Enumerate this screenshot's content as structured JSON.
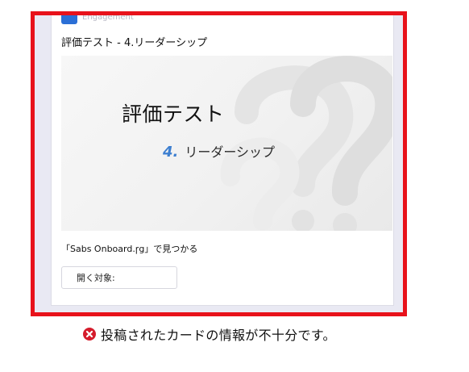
{
  "card": {
    "app_name": "Engagement",
    "title": "評価テスト - 4.リーダーシップ",
    "hero": {
      "title": "評価テスト",
      "subtitle_number": "4.",
      "subtitle_text": "リーダーシップ"
    },
    "found_in": "「Sabs Onboard.ꞅg」で見つかる",
    "open_in_button": "開く対象:"
  },
  "error": {
    "icon": "error-x-circle-icon",
    "message": "投稿されたカードの情報が不十分です。"
  },
  "colors": {
    "error_red": "#e8121b",
    "error_icon": "#d51c2c",
    "accent_blue": "#3d7fd0",
    "logo_blue": "#2b6fd6"
  }
}
